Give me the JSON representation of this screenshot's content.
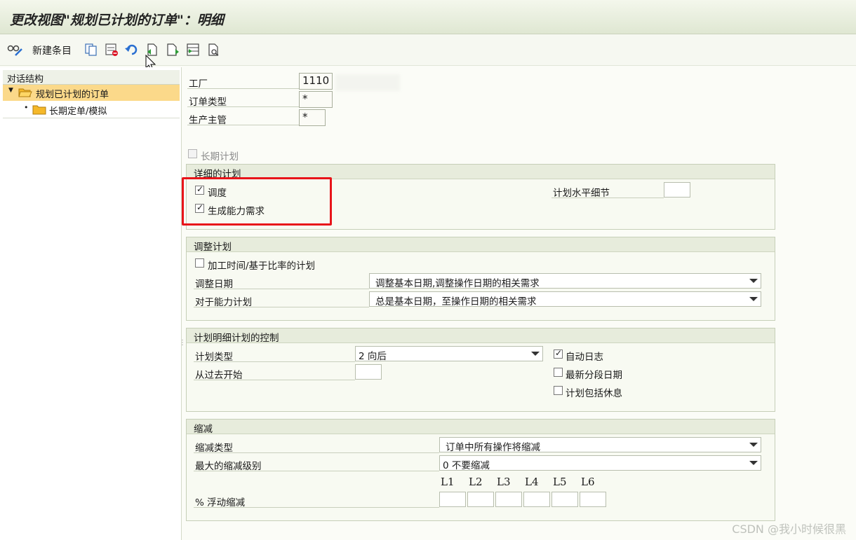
{
  "window": {
    "title": "更改视图\"规划已计划的订单\"：明细"
  },
  "toolbar": {
    "new_entries_label": "新建条目",
    "icons": [
      "glasses-pencil-icon",
      "copy-icon",
      "delete-icon",
      "undo-icon",
      "previous-entry-icon",
      "next-entry-icon",
      "select-all-icon",
      "find-icon"
    ]
  },
  "nav": {
    "header": "对话结构",
    "items": [
      {
        "label": "规划已计划的订单",
        "selected": true
      },
      {
        "label": "长期定单/模拟",
        "selected": false
      }
    ]
  },
  "fields": {
    "plant_label": "工厂",
    "plant_value": "1110",
    "order_type_label": "订单类型",
    "order_type_value": "*",
    "prod_supervisor_label": "生产主管",
    "prod_supervisor_value": "*",
    "long_term_label": "长期计划"
  },
  "detail": {
    "title": "详细的计划",
    "scheduling_label": "调度",
    "scheduling_checked": true,
    "capacity_req_label": "生成能力需求",
    "capacity_req_checked": true,
    "plan_level_label": "计划水平细节"
  },
  "adjust": {
    "title": "调整计划",
    "proc_time_label": "加工时间/基于比率的计划",
    "date_label": "调整日期",
    "date_value": "调整基本日期,调整操作日期的相关需求",
    "capacity_label": "对于能力计划",
    "capacity_value": "总是基本日期，至操作日期的相关需求"
  },
  "control": {
    "title": "计划明细计划的控制",
    "type_label": "计划类型",
    "type_value": "2 向后",
    "start_past_label": "从过去开始",
    "auto_log_label": "自动日志",
    "auto_log_checked": true,
    "latest_date_label": "最新分段日期",
    "include_breaks_label": "计划包括休息"
  },
  "reduction": {
    "title": "缩减",
    "type_label": "缩减类型",
    "type_value": "订单中所有操作将缩减",
    "max_level_label": "最大的缩减级别",
    "max_level_value": "0 不要缩减",
    "float_label": "% 浮动缩减",
    "levels": [
      "L1",
      "L2",
      "L3",
      "L4",
      "L5",
      "L6"
    ]
  },
  "watermark": "CSDN @我小时候很黑",
  "colors": {
    "highlight": "#e8141a",
    "nav_selected": "#fbd98a"
  }
}
